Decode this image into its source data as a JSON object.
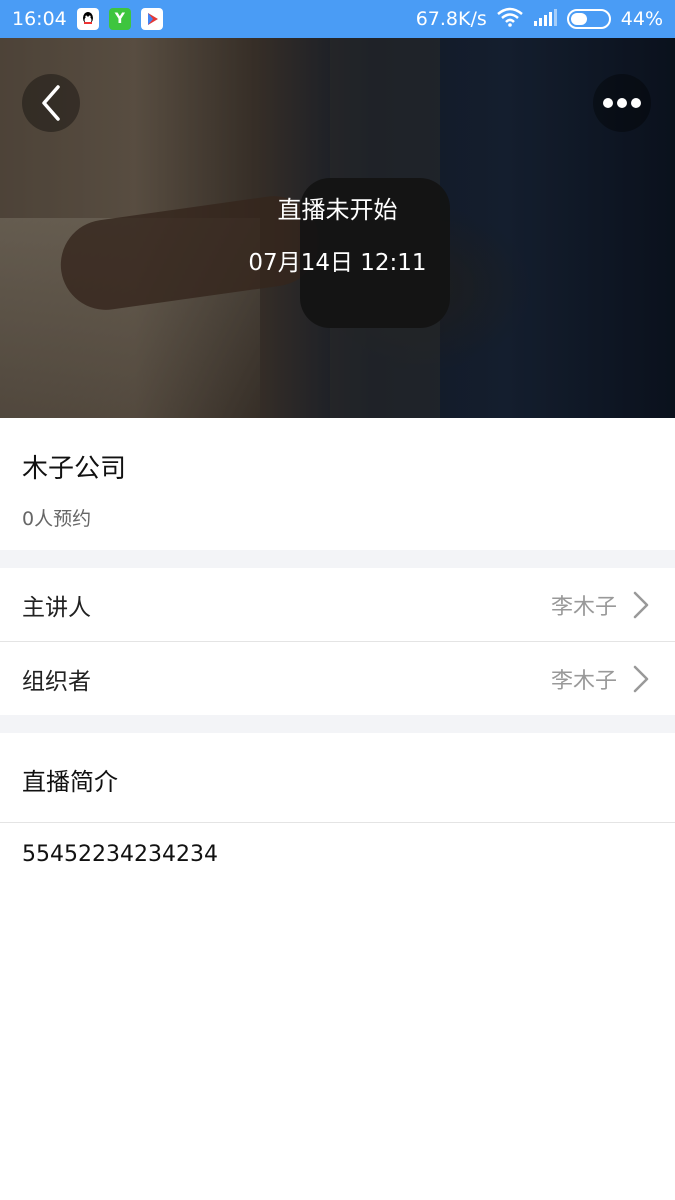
{
  "status_bar": {
    "time": "16:04",
    "net_speed": "67.8K/s",
    "battery": "44%",
    "battery_level": 0.44,
    "icons": [
      "qq-icon",
      "yunzhijia-icon",
      "play-icon",
      "wifi-icon",
      "signal-icon",
      "battery-icon"
    ]
  },
  "hero": {
    "status": "直播未开始",
    "datetime": "07月14日 12:11"
  },
  "info": {
    "title": "木子公司",
    "reservations": "0人预约"
  },
  "rows": [
    {
      "label": "主讲人",
      "value": "李木子"
    },
    {
      "label": "组织者",
      "value": "李木子"
    }
  ],
  "intro": {
    "heading": "直播简介",
    "text": "55452234234234"
  },
  "colors": {
    "status_bar": "#4a9cf5",
    "gap": "#f3f4f7",
    "muted": "#999999"
  }
}
